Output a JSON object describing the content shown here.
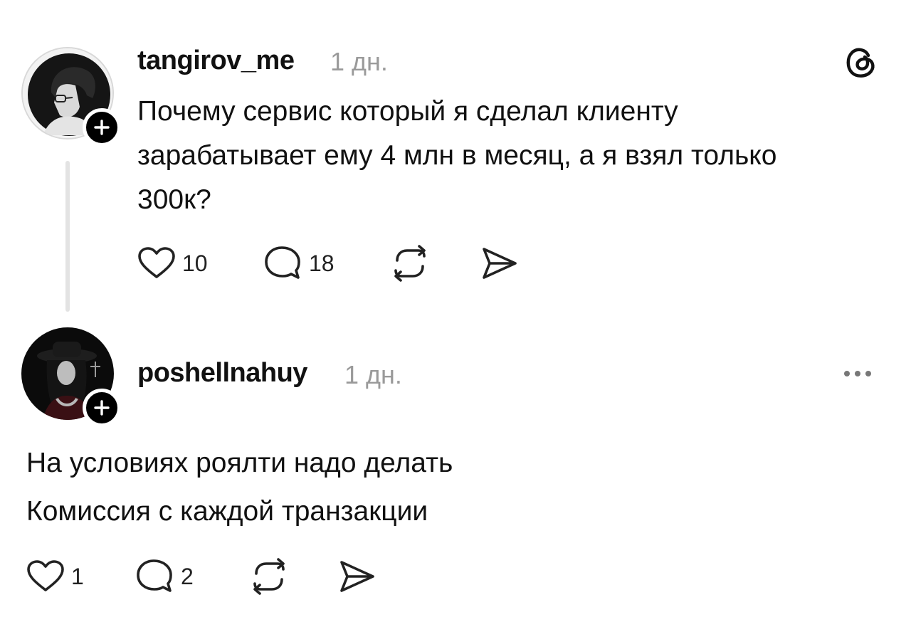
{
  "post": {
    "username": "tangirov_me",
    "time": "1 дн.",
    "lines": [
      "Почему сервис который я сделал клиенту",
      "зарабатывает ему 4 млн в месяц, а я взял только",
      "300к?"
    ],
    "likes": "10",
    "replies": "18",
    "icons": [
      "heart-icon",
      "comment-icon",
      "repost-icon",
      "share-icon",
      "threads-logo-icon"
    ]
  },
  "reply": {
    "username": "poshellnahuy",
    "time": "1 дн.",
    "lines": [
      "На условиях роялти надо делать",
      "Комиссия с каждой транзакции"
    ],
    "likes": "1",
    "replies": "2",
    "icons": [
      "heart-icon",
      "comment-icon",
      "repost-icon",
      "share-icon",
      "more-icon"
    ]
  },
  "colors": {
    "text": "#111111",
    "muted": "#9a9a9a",
    "thread_line": "#e3e3e3",
    "badge": "#000000"
  }
}
